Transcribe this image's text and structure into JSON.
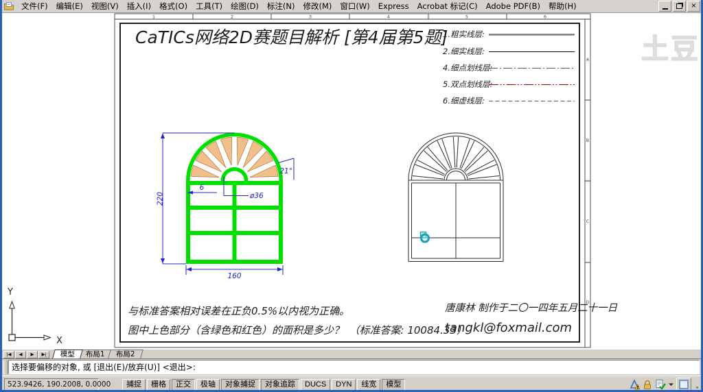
{
  "menu": {
    "items": [
      "文件(F)",
      "编辑(E)",
      "视图(V)",
      "插入(I)",
      "格式(O)",
      "工具(T)",
      "绘图(D)",
      "标注(N)",
      "修改(M)",
      "窗口(W)",
      "Express",
      "Acrobat 标记(C)",
      "Adobe PDF(B)",
      "帮助(H)"
    ]
  },
  "watermark": "土豆",
  "sheet": {
    "title": "CaTICs网络2D赛题目解析 [第4届第5题]",
    "zone_numbers": [
      "1",
      "2",
      "3",
      "4",
      "5",
      "6"
    ],
    "zone_letters": [
      "A",
      "B",
      "C",
      "D"
    ],
    "legend": [
      {
        "label": "1.粗实线层:",
        "style": "thick-solid-gray"
      },
      {
        "label": "2.细实线层:",
        "style": "thin-solid-black"
      },
      {
        "label": "4.细点划线层:",
        "style": "thin-dashdot-gray"
      },
      {
        "label": "5.双点划线层:",
        "style": "thin-double-dashdot-red"
      },
      {
        "label": "6.细虚线层:",
        "style": "thin-dashed-gray"
      }
    ],
    "dimensions": {
      "height": "220",
      "width": "160",
      "thickness": "6",
      "diameter": "ø36",
      "angle": "21°"
    },
    "notes": [
      "与标准答案相对误差在正负0.5%以内视为正确。",
      "图中上色部分（含绿色和红色）的面积是多少？　（标准答案: 10084.33）"
    ],
    "author": "唐康林 制作于二〇一四年五月二十一日",
    "email": "tangkl@foxmail.com"
  },
  "colors": {
    "frame_green": "#00df00",
    "pane_orange": "#f2be8a",
    "dim_blue": "#2222cc",
    "legend_red": "#aa0000",
    "legend_gray": "#7a7a7a",
    "selection_cyan": "#18a2ad"
  },
  "ucs": {
    "x_label": "X",
    "y_label": "Y"
  },
  "tabs": {
    "items": [
      "模型",
      "布局1",
      "布局2"
    ],
    "active": "模型"
  },
  "command": {
    "prompt": "选择要偏移的对象, 或 [退出(E)/放弃(U)] <退出>:"
  },
  "status": {
    "coordinates": "523.9426, 190.2008, 0.0000",
    "buttons": [
      {
        "label": "捕捉",
        "pressed": false
      },
      {
        "label": "栅格",
        "pressed": false
      },
      {
        "label": "正交",
        "pressed": true
      },
      {
        "label": "极轴",
        "pressed": false
      },
      {
        "label": "对象捕捉",
        "pressed": true
      },
      {
        "label": "对象追踪",
        "pressed": true
      },
      {
        "label": "DUCS",
        "pressed": false
      },
      {
        "label": "DYN",
        "pressed": false
      },
      {
        "label": "线宽",
        "pressed": false
      },
      {
        "label": "模型",
        "pressed": true
      }
    ]
  }
}
